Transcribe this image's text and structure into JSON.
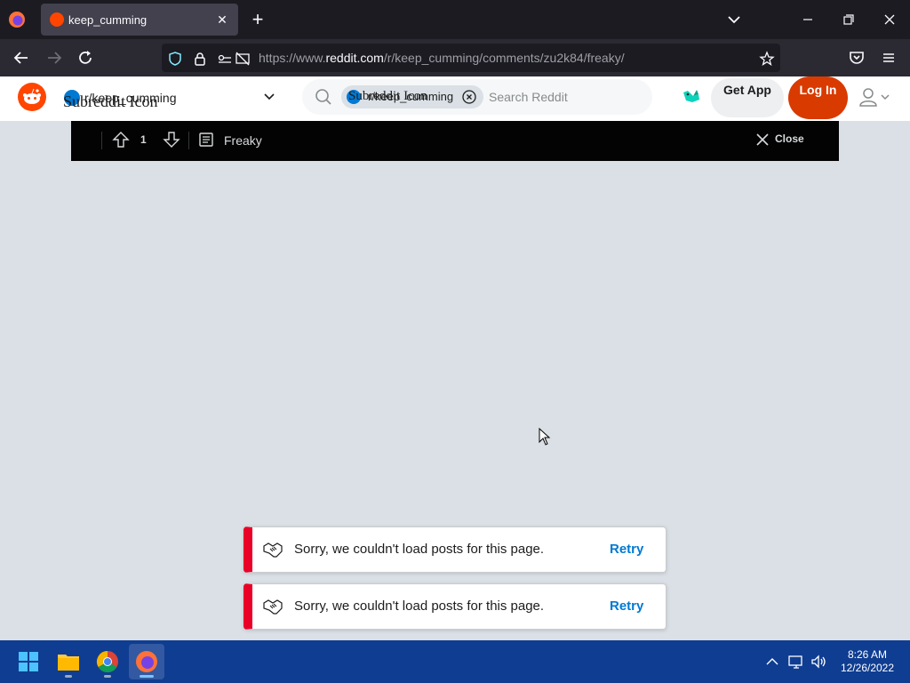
{
  "browser": {
    "tab": {
      "title": "keep_cumming",
      "favicon": "reddit-icon"
    },
    "url": {
      "prefix": "https://www.",
      "host": "reddit.com",
      "path": "/r/keep_cumming/comments/zu2k84/freaky/"
    }
  },
  "reddit": {
    "subreddit": {
      "icon_alt": "Subreddit Icon",
      "name": "r/keep_cumming"
    },
    "search": {
      "chip_alt": "Subreddit Icon",
      "chip_name": "r/keep_cumming",
      "placeholder": "Search Reddit"
    },
    "get_app_label": "Get App",
    "login_label": "Log In",
    "accent": "#d93a00"
  },
  "post_bar": {
    "score": "1",
    "title": "Freaky",
    "close_label": "Close"
  },
  "toasts": [
    {
      "message": "Sorry, we couldn't load posts for this page.",
      "action": "Retry"
    },
    {
      "message": "Sorry, we couldn't load posts for this page.",
      "action": "Retry"
    }
  ],
  "taskbar": {
    "apps": [
      "windows-start-icon",
      "file-explorer-icon",
      "chrome-icon",
      "firefox-icon"
    ],
    "clock": {
      "time": "8:26 AM",
      "date": "12/26/2022"
    }
  }
}
